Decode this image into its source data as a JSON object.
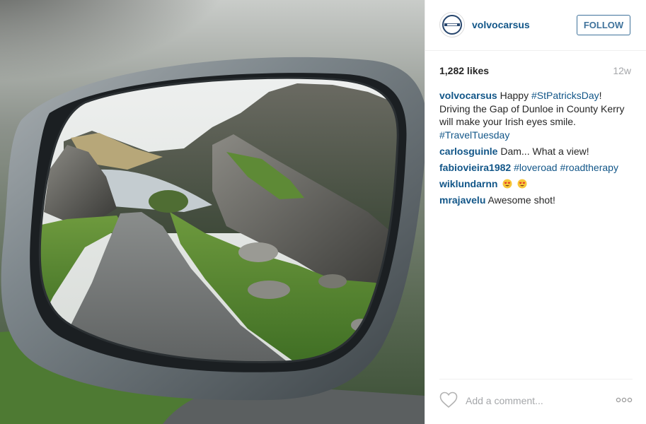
{
  "post": {
    "username": "volvocarsus",
    "follow_label": "FOLLOW",
    "likes": "1,282 likes",
    "age": "12w"
  },
  "caption": {
    "user": "volvocarsus",
    "text_1": " Happy ",
    "tag_1": "#StPatricksDay",
    "text_2": "! Driving the Gap of Dunloe in County Kerry will make your Irish eyes smile. ",
    "tag_2": "#TravelTuesday"
  },
  "comments": [
    {
      "user": "carlosguinle",
      "text": " Dam... What a view!"
    },
    {
      "user": "fabiovieira1982",
      "text": " ",
      "tag_1": "#loveroad",
      "tag_2": "#roadtherapy"
    },
    {
      "user": "wiklundarnn",
      "emoji": "heart-eyes-emoji"
    },
    {
      "user": "mrajavelu",
      "text": " Awesome shot!"
    }
  ],
  "add_comment": {
    "placeholder": "Add a comment..."
  },
  "icons": {
    "avatar": "volvo-logo",
    "like": "heart-icon",
    "more": "more-options-icon"
  },
  "colors": {
    "link": "#125688",
    "follow_border": "#3f729b",
    "muted": "#a5a7aa"
  }
}
